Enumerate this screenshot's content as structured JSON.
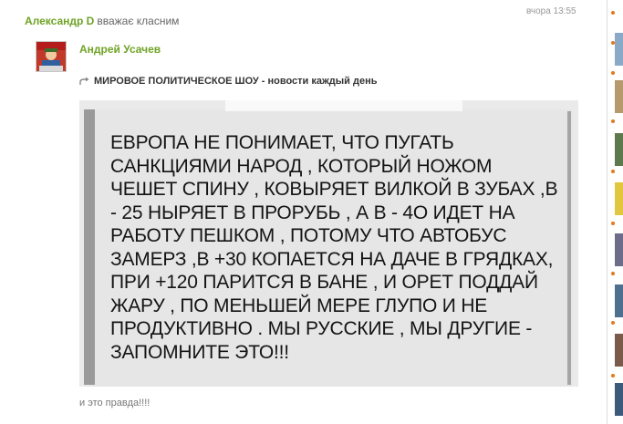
{
  "activity": {
    "user": "Александр D",
    "action": "вважає класним",
    "time": "вчора 13:55"
  },
  "post": {
    "author": "Андрей Усачев",
    "shared_from": "МИРОВОЕ ПОЛИТИЧЕСКОЕ ШОУ - новости каждый день",
    "image_text_lines": [
      "ЕВРОПА НЕ ПОНИМАЕТ, ЧТО ПУГАТЬ",
      "САНКЦИЯМИ НАРОД , КОТОРЫЙ НОЖОМ",
      "ЧЕШЕТ СПИНУ , КОВЫРЯЕТ ВИЛКОЙ В ЗУБАХ ,В",
      "- 25 НЫРЯЕТ В ПРОРУБЬ , А В - 4О ИДЕТ НА",
      "РАБОТУ ПЕШКОМ , ПОТОМУ ЧТО АВТОБУС",
      "ЗАМЕРЗ ,В +30 КОПАЕТСЯ НА ДАЧЕ В ГРЯДКАХ,",
      "ПРИ +120 ПАРИТСЯ В БАНЕ , И ОРЕТ ПОДДАЙ",
      "ЖАРУ , ПО МЕНЬШЕЙ МЕРЕ ГЛУПО И НЕ",
      "ПРОДУКТИВНО . МЫ РУССКИЕ , МЫ ДРУГИЕ -",
      "ЗАПОМНИТЕ ЭТО!!!"
    ],
    "caption": "и это правда!!!!"
  },
  "icons": {
    "share": "share-arrow-icon",
    "avatar": "author-avatar"
  },
  "colors": {
    "link_green": "#6fa325",
    "accent_orange": "#e07a1f"
  }
}
